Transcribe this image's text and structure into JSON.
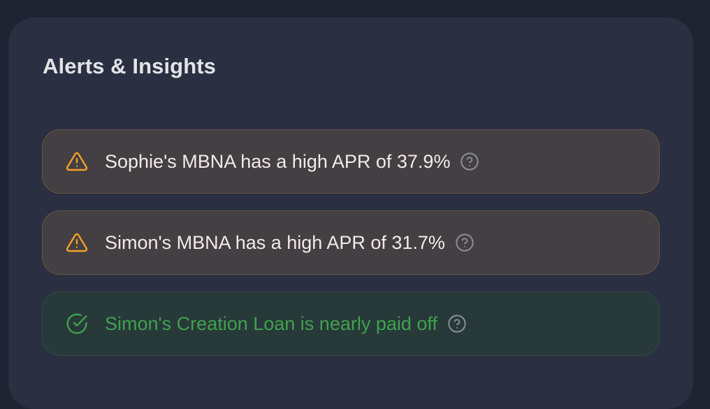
{
  "card": {
    "title": "Alerts & Insights"
  },
  "alerts": [
    {
      "type": "warning",
      "icon": "warning-triangle-icon",
      "text": "Sophie's MBNA has a high APR of 37.9%"
    },
    {
      "type": "warning",
      "icon": "warning-triangle-icon",
      "text": "Simon's MBNA has a high APR of 31.7%"
    },
    {
      "type": "success",
      "icon": "check-circle-icon",
      "text": "Simon's Creation Loan is nearly paid off"
    }
  ],
  "colors": {
    "warning_accent": "#f5a02a",
    "success_accent": "#3fa24c",
    "help_icon": "#8b8f97"
  }
}
